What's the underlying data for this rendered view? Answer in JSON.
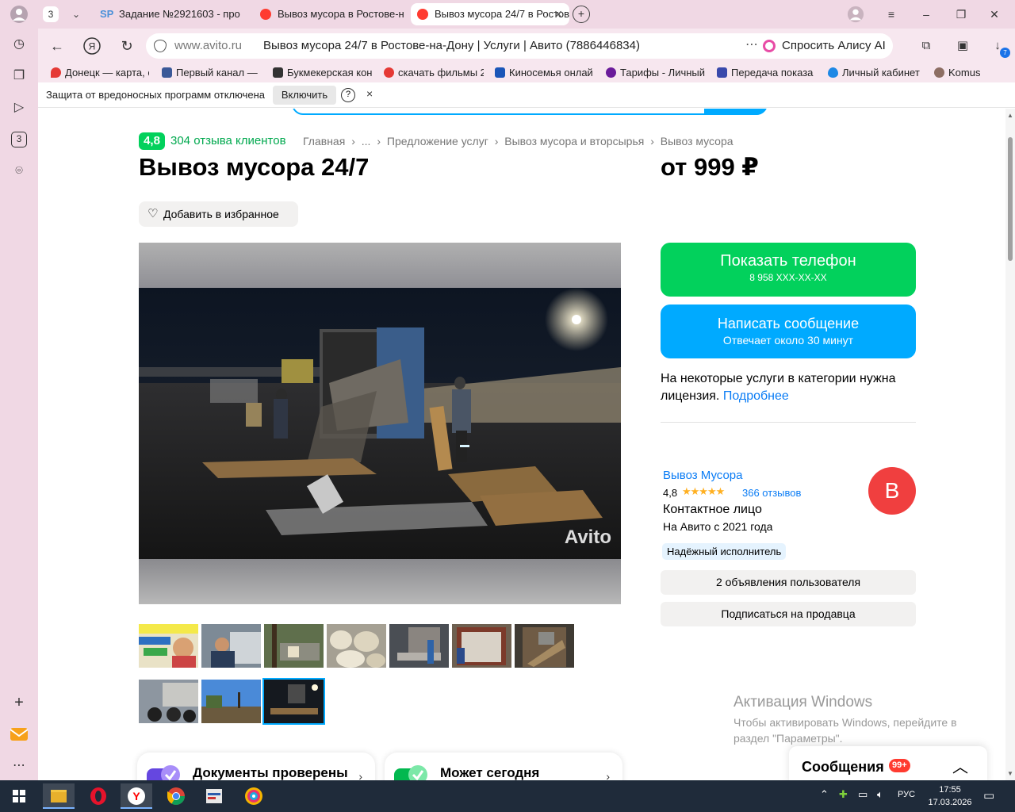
{
  "browser": {
    "tab_count": "3",
    "tabs": [
      {
        "title": "Задание №2921603 - про",
        "icon": "sp-icon",
        "fav_text": "SP"
      },
      {
        "title": "Вывоз мусора в Ростове-н",
        "icon": "avito-icon"
      },
      {
        "title": "Вывоз мусора 24/7 в Ростове",
        "icon": "avito-icon"
      }
    ],
    "domain": "www.avito.ru",
    "page_title": "Вывоз мусора 24/7 в Ростове-на-Дону | Услуги | Авито (7886446834)",
    "alice_label": "Спросить Алису AI",
    "downloads_badge": "7",
    "side_counter": "3",
    "bookmarks": [
      {
        "label": "Донецк — карта, с",
        "color": "#e53935"
      },
      {
        "label": "Первый канал — с",
        "color": "#3b5998"
      },
      {
        "label": "Букмекерская кон",
        "color": "#333333"
      },
      {
        "label": "скачать фильмы 2",
        "color": "#e53935"
      },
      {
        "label": "Киносемья онлай",
        "color": "#1a56b8"
      },
      {
        "label": "Тарифы - Личный",
        "color": "#6a1b9a"
      },
      {
        "label": "Передача показа",
        "color": "#3949ab"
      },
      {
        "label": "Личный кабинет",
        "color": "#1e88e5"
      },
      {
        "label": "Komus",
        "color": "#8d6e63"
      }
    ],
    "notification": {
      "text": "Защита от вредоносных программ отключена",
      "enable_label": "Включить",
      "help_label": "?",
      "close_label": "×"
    }
  },
  "listing": {
    "rating": "4,8",
    "reviews_link": "304 отзыва клиентов",
    "breadcrumb": [
      "Главная",
      "...",
      "Предложение услуг",
      "Вывоз мусора и вторсырья",
      "Вывоз мусора"
    ],
    "breadcrumb_sep": "›",
    "title": "Вывоз мусора 24/7",
    "price": "от 999 ₽",
    "favorite_label": "Добавить в избранное",
    "watermark": "Avito",
    "thumbnail_count": 10,
    "selected_thumbnail": 10,
    "features": [
      {
        "label": "Документы проверены",
        "icon": "documents-check-icon",
        "color": "#7b5cf5"
      },
      {
        "label": "Может сегодня",
        "icon": "today-check-icon",
        "color": "#02d15c"
      }
    ]
  },
  "actions": {
    "show_phone": "Показать телефон",
    "phone_masked": "8 958 XXX-XX-XX",
    "write_message": "Написать сообщение",
    "reply_time": "Отвечает около 30 минут",
    "license_text": "На некоторые услуги в категории нужна лицензия.",
    "license_link": "Подробнее"
  },
  "seller": {
    "name": "Вывоз Мусора",
    "score": "4,8",
    "stars": "★★★★★",
    "reviews": "366 отзывов",
    "contact": "Контактное лицо",
    "since": "На Авито с 2021 года",
    "avatar_letter": "В",
    "badge": "Надёжный исполнитель",
    "ads_button": "2 объявления пользователя",
    "subscribe_button": "Подписаться на продавца"
  },
  "windows": {
    "activation_title": "Активация Windows",
    "activation_text": "Чтобы активировать Windows, перейдите в раздел \"Параметры\"."
  },
  "messages": {
    "label": "Сообщения",
    "badge": "99+"
  },
  "taskbar": {
    "lang": "РУС",
    "time": "17:55",
    "date": "17.03.2026"
  },
  "colors": {
    "avito_green": "#02d15c",
    "avito_blue": "#00aaff",
    "link_blue": "#0a7cf5",
    "browser_pink": "#f0d8e4"
  }
}
